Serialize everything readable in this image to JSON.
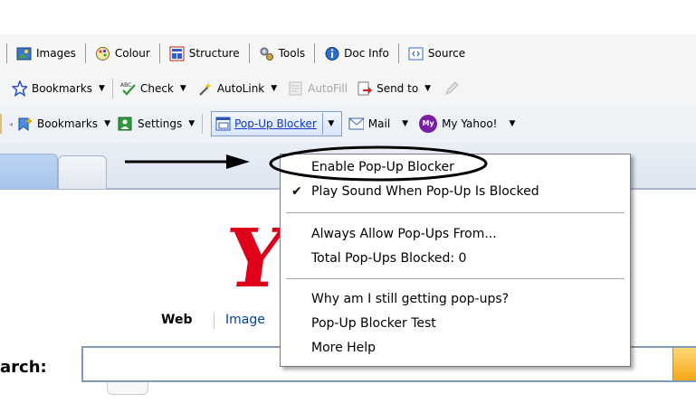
{
  "toolbar1": {
    "images": "Images",
    "colour": "Colour",
    "structure": "Structure",
    "tools": "Tools",
    "docinfo": "Doc Info",
    "source": "Source"
  },
  "toolbar2": {
    "bookmarks": "Bookmarks",
    "check": "Check",
    "autolink": "AutoLink",
    "autofill": "AutoFill",
    "sendto": "Send to"
  },
  "toolbar3": {
    "bookmarks": "Bookmarks",
    "settings": "Settings",
    "popup_blocker": "Pop-Up Blocker",
    "mail": "Mail",
    "myyahoo": "My Yahoo!",
    "myyahoo_badge": "My"
  },
  "page": {
    "logo_letter": "Y",
    "web": "Web",
    "images": "Image",
    "search_label": "arch:"
  },
  "menu": {
    "items": [
      "Enable Pop-Up Blocker",
      "Play Sound When Pop-Up Is Blocked",
      "Always Allow Pop-Ups From...",
      "Total Pop-Ups Blocked: 0",
      "Why am I still getting pop-ups?",
      "Pop-Up Blocker Test",
      "More Help"
    ]
  },
  "colors": {
    "accent": "#1035c8",
    "yahoo_red": "#e1001a",
    "highlight_oval": "#000000"
  },
  "icons": [
    "images-icon",
    "colour-icon",
    "structure-icon",
    "tools-icon",
    "docinfo-icon",
    "source-icon",
    "star-icon",
    "spellcheck-icon",
    "wand-icon",
    "autofill-icon",
    "sendto-icon",
    "pencil-icon",
    "bookmark-add-icon",
    "settings-icon",
    "popup-blocker-icon",
    "mail-icon",
    "myyahoo-icon",
    "checkmark-icon",
    "arrow-icon"
  ]
}
